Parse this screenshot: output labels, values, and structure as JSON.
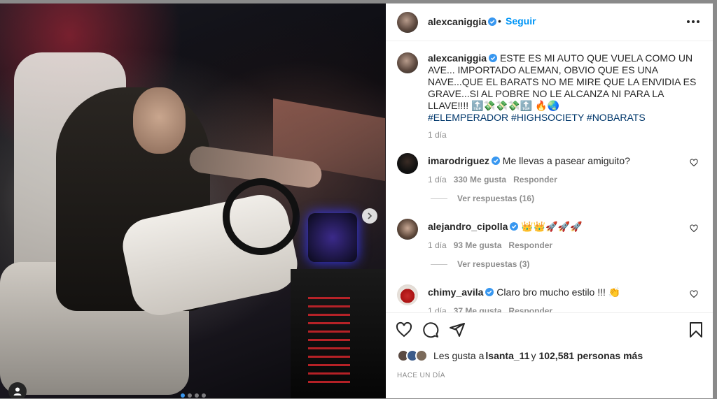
{
  "post": {
    "author": "alexcaniggia",
    "follow_label": "Seguir",
    "dot": "•",
    "caption_text": "ESTE ES MI AUTO QUE VUELA COMO UN AVE... IMPORTADO ALEMAN, OBVIO QUE ES UNA NAVE...QUE EL BARATS NO ME MIRE QUE LA ENVIDIA ES GRAVE...SI AL POBRE NO LE ALCANZA NI PARA LA LLAVE!!!! 🔝💸💸💸🔝 🔥🌏",
    "hashtags": "#ELEMPERADOR #HIGHSOCIETY #NOBARATS",
    "caption_time": "1 día"
  },
  "comments": [
    {
      "user": "imarodriguez",
      "text": "Me llevas a pasear amiguito?",
      "time": "1 día",
      "likes": "330 Me gusta",
      "reply": "Responder",
      "replies": "Ver respuestas (16)"
    },
    {
      "user": "alejandro_cipolla",
      "text": "👑👑🚀🚀🚀",
      "time": "1 día",
      "likes": "93 Me gusta",
      "reply": "Responder",
      "replies": "Ver respuestas (3)"
    },
    {
      "user": "chimy_avila",
      "text": "Claro bro mucho estilo !!! 👏",
      "time": "1 día",
      "likes": "37 Me gusta",
      "reply": "Responder"
    }
  ],
  "footer": {
    "likes_prefix": "Les gusta a ",
    "likes_user": "lsanta_11",
    "likes_mid": " y ",
    "likes_count": "102,581 personas más",
    "date": "HACE UN DÍA"
  },
  "colors": {
    "accent": "#0095f6",
    "hashtag": "#00376b",
    "muted": "#8e8e8e",
    "text": "#262626"
  },
  "icons": [
    "verified-badge-icon",
    "more-options-icon",
    "heart-icon",
    "comment-icon",
    "share-icon",
    "bookmark-icon",
    "user-tag-icon",
    "chevron-right-icon"
  ]
}
